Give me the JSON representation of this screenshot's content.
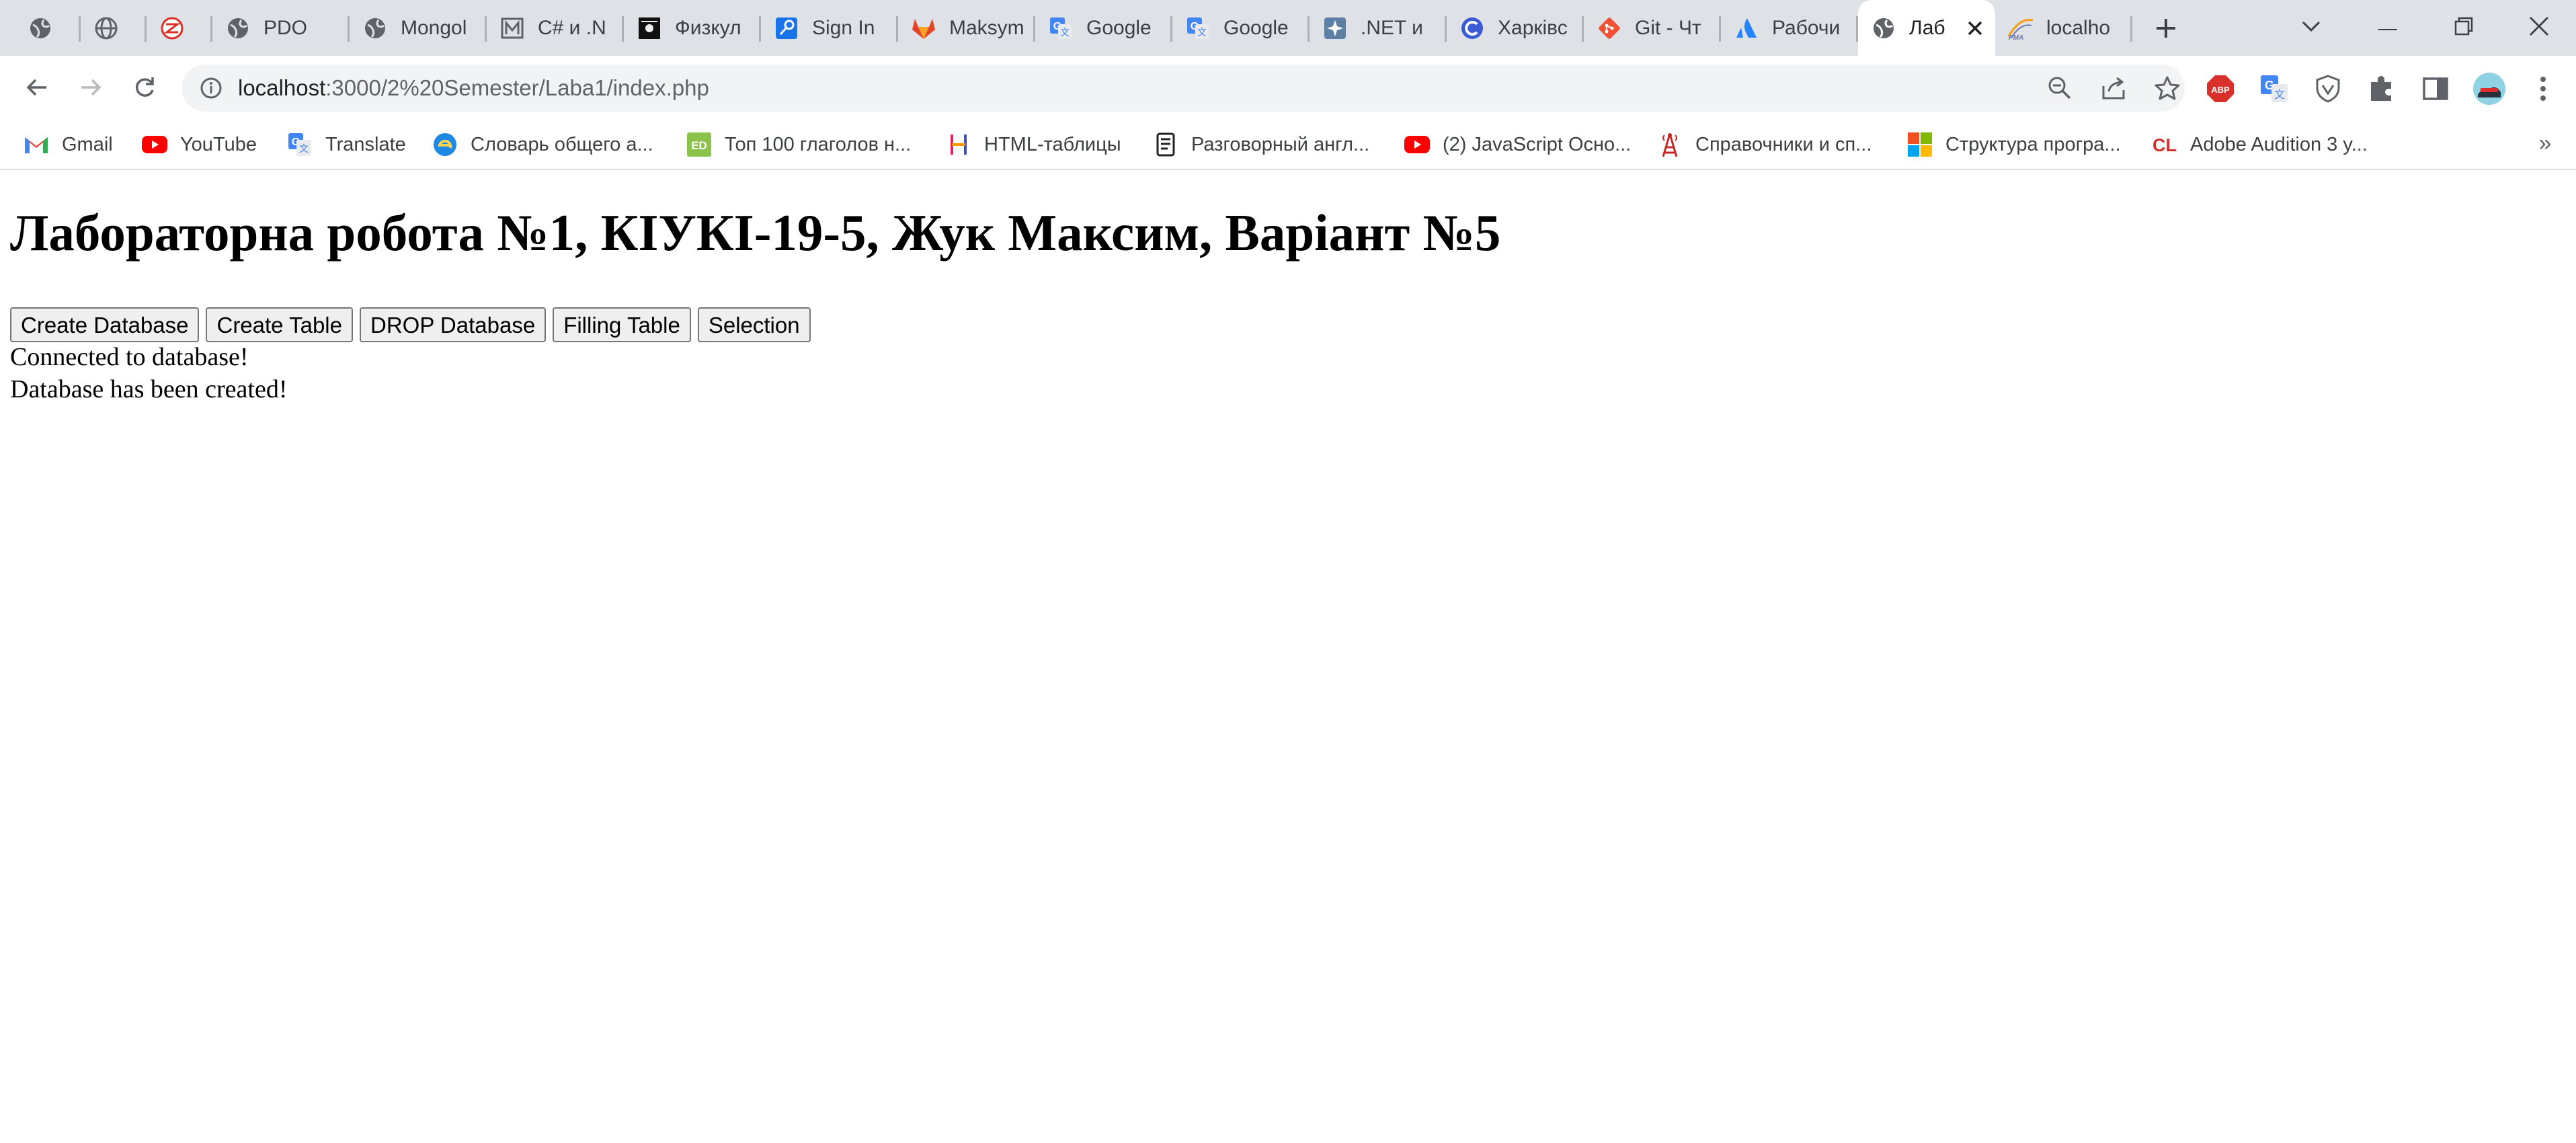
{
  "browser": {
    "tabs": [
      {
        "title": "",
        "icon": "globe-icon"
      },
      {
        "title": "",
        "icon": "globe-icon"
      },
      {
        "title": "",
        "icon": "zs-icon"
      },
      {
        "title": "PDO",
        "icon": "globe-icon"
      },
      {
        "title": "Mongol",
        "icon": "globe-icon"
      },
      {
        "title": "C# и .N",
        "icon": "m-icon"
      },
      {
        "title": "Физкул",
        "icon": "dark-square-icon"
      },
      {
        "title": "Sign In",
        "icon": "key-icon"
      },
      {
        "title": "Maksym",
        "icon": "gitlab-icon"
      },
      {
        "title": "Google",
        "icon": "translate-icon"
      },
      {
        "title": "Google",
        "icon": "translate-icon"
      },
      {
        "title": ".NET и",
        "icon": "star-icon"
      },
      {
        "title": "Харківс",
        "icon": "c-icon"
      },
      {
        "title": "Git - Чт",
        "icon": "git-icon"
      },
      {
        "title": "Рабочи",
        "icon": "atlassian-icon"
      },
      {
        "title": "Лаб",
        "icon": "globe-icon",
        "active": true
      },
      {
        "title": "localho",
        "icon": "pma-icon"
      }
    ],
    "new_tab_symbol": "+",
    "url": {
      "host": "localhost",
      "path": ":3000/2%20Semester/Laba1/index.php"
    },
    "bookmarks": [
      {
        "label": "Gmail",
        "icon": "gmail-icon"
      },
      {
        "label": "YouTube",
        "icon": "youtube-icon"
      },
      {
        "label": "Translate",
        "icon": "translate-icon"
      },
      {
        "label": "Словарь общего а...",
        "icon": "e-icon"
      },
      {
        "label": "Топ 100 глаголов н...",
        "icon": "ed-icon"
      },
      {
        "label": "HTML-таблицы",
        "icon": "h-icon"
      },
      {
        "label": "Разговорный англ...",
        "icon": "scroll-icon"
      },
      {
        "label": "(2) JavaScript Осно...",
        "icon": "youtube-icon"
      },
      {
        "label": "Справочники и сп...",
        "icon": "tower-icon"
      },
      {
        "label": "Структура програ...",
        "icon": "microsoft-icon"
      },
      {
        "label": "Adobe Audition 3 y...",
        "icon": "cl-icon"
      }
    ],
    "bookmarks_more": "»",
    "colors": {
      "tabstrip": "#dee1e6",
      "omnibox": "#f1f3f4"
    }
  },
  "page": {
    "heading": "Лабораторна робота №1, КІУКІ-19-5, Жук Максим, Варіант №5",
    "buttons": {
      "create_db": "Create Database",
      "create_table": "Create Table",
      "drop_db": "DROP Database",
      "filling_table": "Filling Table",
      "selection": "Selection"
    },
    "messages": {
      "connected": "Connected to database!",
      "created": "Database has been created!"
    }
  }
}
